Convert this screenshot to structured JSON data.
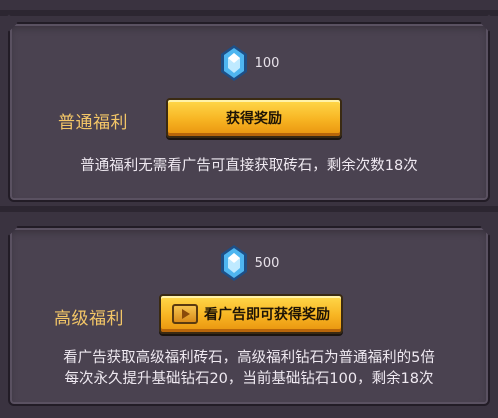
{
  "rewards": [
    {
      "gem_amount": "100",
      "tier_label": "普通福利",
      "button_label": "获得奖励",
      "description_lines": [
        "普通福利无需看广告可直接获取砖石，剩余次数18次"
      ]
    },
    {
      "gem_amount": "500",
      "tier_label": "高级福利",
      "button_label": "看广告即可获得奖励",
      "description_lines": [
        "看广告获取高级福利砖石，高级福利钻石为普通福利的5倍",
        "每次永久提升基础钻石20，当前基础钻石100，剩余18次"
      ]
    }
  ],
  "colors": {
    "background": "#3a3340",
    "panel": "#4a4250",
    "label_gold": "#f3c667",
    "button_yellow": "#f7b422",
    "gem_blue": "#4fb6f0"
  },
  "icons": {
    "gem": "diamond-gem-icon",
    "video": "video-ad-icon"
  }
}
